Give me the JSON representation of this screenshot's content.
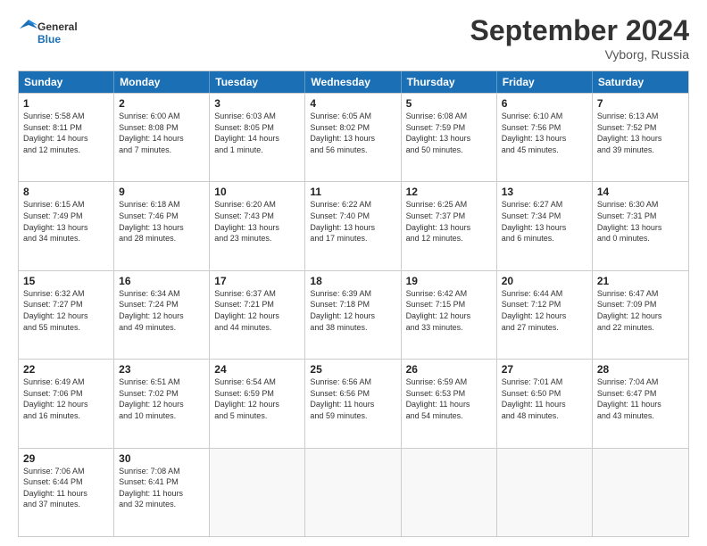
{
  "header": {
    "logo_general": "General",
    "logo_blue": "Blue",
    "month_title": "September 2024",
    "subtitle": "Vyborg, Russia"
  },
  "weekdays": [
    "Sunday",
    "Monday",
    "Tuesday",
    "Wednesday",
    "Thursday",
    "Friday",
    "Saturday"
  ],
  "rows": [
    [
      {
        "day": "1",
        "info": "Sunrise: 5:58 AM\nSunset: 8:11 PM\nDaylight: 14 hours\nand 12 minutes."
      },
      {
        "day": "2",
        "info": "Sunrise: 6:00 AM\nSunset: 8:08 PM\nDaylight: 14 hours\nand 7 minutes."
      },
      {
        "day": "3",
        "info": "Sunrise: 6:03 AM\nSunset: 8:05 PM\nDaylight: 14 hours\nand 1 minute."
      },
      {
        "day": "4",
        "info": "Sunrise: 6:05 AM\nSunset: 8:02 PM\nDaylight: 13 hours\nand 56 minutes."
      },
      {
        "day": "5",
        "info": "Sunrise: 6:08 AM\nSunset: 7:59 PM\nDaylight: 13 hours\nand 50 minutes."
      },
      {
        "day": "6",
        "info": "Sunrise: 6:10 AM\nSunset: 7:56 PM\nDaylight: 13 hours\nand 45 minutes."
      },
      {
        "day": "7",
        "info": "Sunrise: 6:13 AM\nSunset: 7:52 PM\nDaylight: 13 hours\nand 39 minutes."
      }
    ],
    [
      {
        "day": "8",
        "info": "Sunrise: 6:15 AM\nSunset: 7:49 PM\nDaylight: 13 hours\nand 34 minutes."
      },
      {
        "day": "9",
        "info": "Sunrise: 6:18 AM\nSunset: 7:46 PM\nDaylight: 13 hours\nand 28 minutes."
      },
      {
        "day": "10",
        "info": "Sunrise: 6:20 AM\nSunset: 7:43 PM\nDaylight: 13 hours\nand 23 minutes."
      },
      {
        "day": "11",
        "info": "Sunrise: 6:22 AM\nSunset: 7:40 PM\nDaylight: 13 hours\nand 17 minutes."
      },
      {
        "day": "12",
        "info": "Sunrise: 6:25 AM\nSunset: 7:37 PM\nDaylight: 13 hours\nand 12 minutes."
      },
      {
        "day": "13",
        "info": "Sunrise: 6:27 AM\nSunset: 7:34 PM\nDaylight: 13 hours\nand 6 minutes."
      },
      {
        "day": "14",
        "info": "Sunrise: 6:30 AM\nSunset: 7:31 PM\nDaylight: 13 hours\nand 0 minutes."
      }
    ],
    [
      {
        "day": "15",
        "info": "Sunrise: 6:32 AM\nSunset: 7:27 PM\nDaylight: 12 hours\nand 55 minutes."
      },
      {
        "day": "16",
        "info": "Sunrise: 6:34 AM\nSunset: 7:24 PM\nDaylight: 12 hours\nand 49 minutes."
      },
      {
        "day": "17",
        "info": "Sunrise: 6:37 AM\nSunset: 7:21 PM\nDaylight: 12 hours\nand 44 minutes."
      },
      {
        "day": "18",
        "info": "Sunrise: 6:39 AM\nSunset: 7:18 PM\nDaylight: 12 hours\nand 38 minutes."
      },
      {
        "day": "19",
        "info": "Sunrise: 6:42 AM\nSunset: 7:15 PM\nDaylight: 12 hours\nand 33 minutes."
      },
      {
        "day": "20",
        "info": "Sunrise: 6:44 AM\nSunset: 7:12 PM\nDaylight: 12 hours\nand 27 minutes."
      },
      {
        "day": "21",
        "info": "Sunrise: 6:47 AM\nSunset: 7:09 PM\nDaylight: 12 hours\nand 22 minutes."
      }
    ],
    [
      {
        "day": "22",
        "info": "Sunrise: 6:49 AM\nSunset: 7:06 PM\nDaylight: 12 hours\nand 16 minutes."
      },
      {
        "day": "23",
        "info": "Sunrise: 6:51 AM\nSunset: 7:02 PM\nDaylight: 12 hours\nand 10 minutes."
      },
      {
        "day": "24",
        "info": "Sunrise: 6:54 AM\nSunset: 6:59 PM\nDaylight: 12 hours\nand 5 minutes."
      },
      {
        "day": "25",
        "info": "Sunrise: 6:56 AM\nSunset: 6:56 PM\nDaylight: 11 hours\nand 59 minutes."
      },
      {
        "day": "26",
        "info": "Sunrise: 6:59 AM\nSunset: 6:53 PM\nDaylight: 11 hours\nand 54 minutes."
      },
      {
        "day": "27",
        "info": "Sunrise: 7:01 AM\nSunset: 6:50 PM\nDaylight: 11 hours\nand 48 minutes."
      },
      {
        "day": "28",
        "info": "Sunrise: 7:04 AM\nSunset: 6:47 PM\nDaylight: 11 hours\nand 43 minutes."
      }
    ],
    [
      {
        "day": "29",
        "info": "Sunrise: 7:06 AM\nSunset: 6:44 PM\nDaylight: 11 hours\nand 37 minutes."
      },
      {
        "day": "30",
        "info": "Sunrise: 7:08 AM\nSunset: 6:41 PM\nDaylight: 11 hours\nand 32 minutes."
      },
      {
        "day": "",
        "info": ""
      },
      {
        "day": "",
        "info": ""
      },
      {
        "day": "",
        "info": ""
      },
      {
        "day": "",
        "info": ""
      },
      {
        "day": "",
        "info": ""
      }
    ]
  ]
}
